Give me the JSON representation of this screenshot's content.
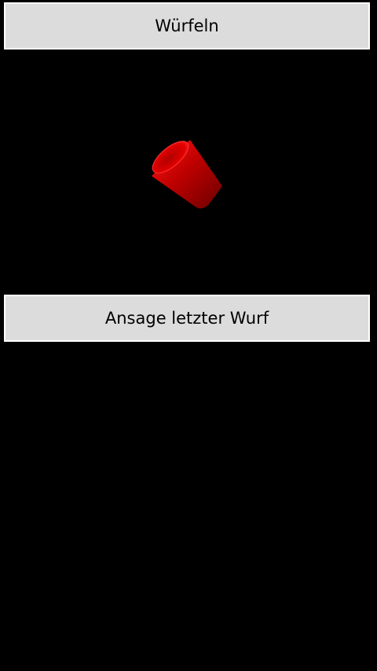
{
  "buttons": {
    "roll_label": "Würfeln",
    "announce_label": "Ansage letzter Wurf"
  },
  "dice_cup": {
    "icon": "dice-cup-icon",
    "color": "#cc0000"
  }
}
